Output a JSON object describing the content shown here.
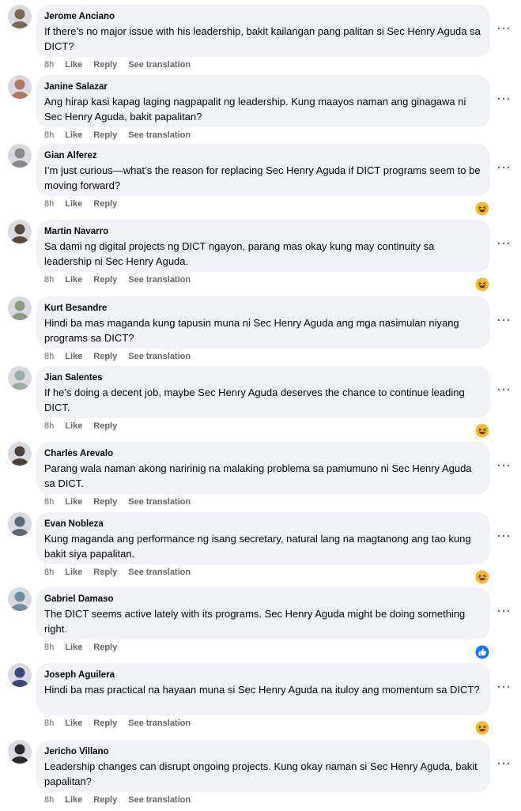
{
  "comments": [
    {
      "author": "Jerome Anciano",
      "text": "If there’s no major issue with his leadership, bakit kailangan pang palitan si Sec Henry Aguda sa DICT?",
      "time": "8h",
      "like": "Like",
      "reply": "Reply",
      "translate": "See translation",
      "reaction": null,
      "avatar_color": "#7a6a55"
    },
    {
      "author": "Janine Salazar",
      "text": "Ang hirap kasi kapag laging nagpapalit ng leadership. Kung maayos naman ang ginagawa ni Sec Henry Aguda, bakit papalitan?",
      "time": "8h",
      "like": "Like",
      "reply": "Reply",
      "translate": "See translation",
      "reaction": null,
      "avatar_color": "#b07a62"
    },
    {
      "author": "Gian Alferez",
      "text": "I’m just curious—what’s the reason for replacing Sec Henry Aguda if DICT programs seem to be moving forward?",
      "time": "8h",
      "like": "Like",
      "reply": "Reply",
      "translate": "",
      "reaction": "haha",
      "avatar_color": "#8a8a8a"
    },
    {
      "author": "Martin Navarro",
      "text": "Sa dami ng digital projects ng DICT ngayon, parang mas okay kung may continuity sa leadership ni Sec Henry Aguda.",
      "time": "8h",
      "like": "Like",
      "reply": "Reply",
      "translate": "See translation",
      "reaction": "haha",
      "avatar_color": "#5a4a3c"
    },
    {
      "author": "Kurt Besandre",
      "text": "Hindi ba mas maganda kung tapusin muna ni Sec Henry Aguda ang mga nasimulan niyang programs sa DICT?",
      "time": "8h",
      "like": "Like",
      "reply": "Reply",
      "translate": "See translation",
      "reaction": null,
      "avatar_color": "#8e9a7e"
    },
    {
      "author": "Jian Salentes",
      "text": "If he’s doing a decent job, maybe Sec Henry Aguda deserves the chance to continue leading DICT.",
      "time": "8h",
      "like": "Like",
      "reply": "Reply",
      "translate": "",
      "reaction": "haha",
      "avatar_color": "#9bb0a5"
    },
    {
      "author": "Charles Arevalo",
      "text": "Parang wala naman akong naririnig na malaking problema sa pamumuno ni Sec Henry Aguda sa DICT.",
      "time": "8h",
      "like": "Like",
      "reply": "Reply",
      "translate": "See translation",
      "reaction": null,
      "avatar_color": "#4a4038"
    },
    {
      "author": "Evan Nobleza",
      "text": "Kung maganda ang performance ng isang secretary, natural lang na magtanong ang tao kung bakit siya papalitan.",
      "time": "8h",
      "like": "Like",
      "reply": "Reply",
      "translate": "See translation",
      "reaction": "haha",
      "avatar_color": "#5a6a7a"
    },
    {
      "author": "Gabriel Damaso",
      "text": "The DICT seems active lately with its programs. Sec Henry Aguda might be doing something right.",
      "time": "8h",
      "like": "Like",
      "reply": "Reply",
      "translate": "",
      "reaction": "like",
      "avatar_color": "#6f8fa6"
    },
    {
      "author": "Joseph Aguilera",
      "text": "Hindi ba mas practical na hayaan muna si Sec Henry Aguda na ituloy ang momentum sa DICT?",
      "time": "8h",
      "like": "Like",
      "reply": "Reply",
      "translate": "See translation",
      "reaction": "haha",
      "avatar_color": "#3a4a7a"
    },
    {
      "author": "Jericho Villano",
      "text": "Leadership changes can disrupt ongoing projects. Kung okay naman si Sec Henry Aguda, bakit papalitan?",
      "time": "8h",
      "like": "Like",
      "reply": "Reply",
      "translate": "See translation",
      "reaction": null,
      "avatar_color": "#2a2a2a"
    }
  ],
  "more_label": "···",
  "colors": {
    "bubble": "#f0f2f5",
    "meta": "#65676b",
    "haha": "#f7b928",
    "like": "#1877f2"
  }
}
